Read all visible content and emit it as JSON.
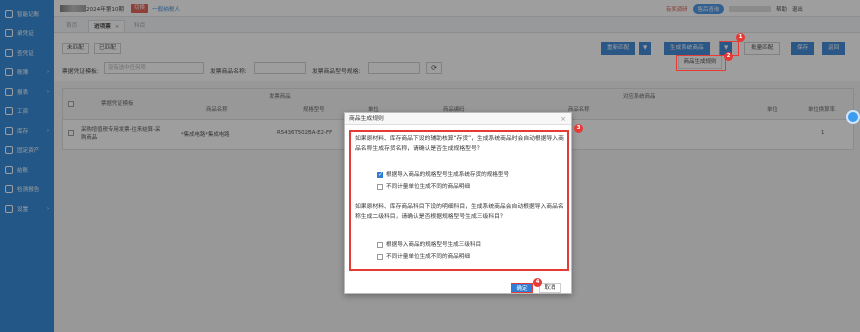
{
  "sidebar": {
    "items": [
      {
        "label": "智能记账",
        "icon": "smart-bookkeeping-icon"
      },
      {
        "label": "录凭证",
        "icon": "record-voucher-icon"
      },
      {
        "label": "查凭证",
        "icon": "search-voucher-icon"
      },
      {
        "label": "账簿",
        "icon": "ledger-icon",
        "arrow": "›"
      },
      {
        "label": "报表",
        "icon": "report-icon",
        "arrow": "›"
      },
      {
        "label": "工资",
        "icon": "salary-icon"
      },
      {
        "label": "库存",
        "icon": "inventory-icon",
        "arrow": "›"
      },
      {
        "label": "固定资产",
        "icon": "fixed-asset-icon"
      },
      {
        "label": "结账",
        "icon": "close-account-icon"
      },
      {
        "label": "检测报告",
        "icon": "check-report-icon"
      },
      {
        "label": "设置",
        "icon": "settings-icon",
        "arrow": "›"
      }
    ]
  },
  "topbar": {
    "period": "2024年第10期",
    "switch_label": "切换",
    "taxpayer": "一般纳税人",
    "survey": "有奖调研",
    "service": "售后咨询",
    "help": "帮助",
    "exit": "退出"
  },
  "tabs": {
    "home": "首页",
    "active": "进项票",
    "close": "×",
    "subject": "科目"
  },
  "toolbar": {
    "unmatched": "未匹配",
    "matched": "已匹配",
    "resmatch": "重新匹配",
    "generate": "生成系统商品",
    "batch": "批量匹配",
    "save": "保存",
    "back": "返回",
    "menu_item": "商品生成规则",
    "dropdown_arrow": "▼"
  },
  "filters": {
    "template_label": "票据凭证模板:",
    "template_placeholder": "没有选中任何项",
    "name_label": "发票商品名称:",
    "spec_label": "发票商品型号规格:",
    "refresh": "⟳"
  },
  "table": {
    "headers": {
      "template": "票据凭证模板",
      "invoice_group": "发票商品",
      "product_name": "商品名称",
      "spec": "规格型号",
      "unit": "单位",
      "code": "商品编码",
      "sys_group": "对应系统商品",
      "sys_name": "商品名称",
      "sys_unit": "单位",
      "factor": "单位换算率"
    },
    "rows": [
      {
        "template": "采购增值税专用发票-往来结算-采购商品",
        "name": "*集成电路*集成电路",
        "spec": "R5436T502BA-E2-FF",
        "factor": "1"
      }
    ]
  },
  "dialog": {
    "title": "商品生成规则",
    "close": "×",
    "para1": "如果原材料、库存商品下设的辅助核算“存货”，生成系统商品时会自动根据导入商品名称生成存货名称，请确认是否生成规格型号？",
    "opt1": "根据导入商品的规格型号生成系统存货的规格型号",
    "opt2": "不同计量单位生成不同的商品明细",
    "para2": "如果原材料、库存商品科目下设的明细科目，生成系统商品会自动根据导入商品名称生成二级科目，请确认是否根据规格型号生成三级科目？",
    "opt3": "根据导入商品的规格型号生成三级科目",
    "opt4": "不同计量单位生成不同的商品明细",
    "ok": "确定",
    "cancel": "取消"
  },
  "callouts": [
    "1",
    "2",
    "3",
    "4"
  ],
  "colors": {
    "sidebar": "#1e7fd6",
    "primary": "#2e7ed6",
    "highlight": "#e63a36"
  }
}
